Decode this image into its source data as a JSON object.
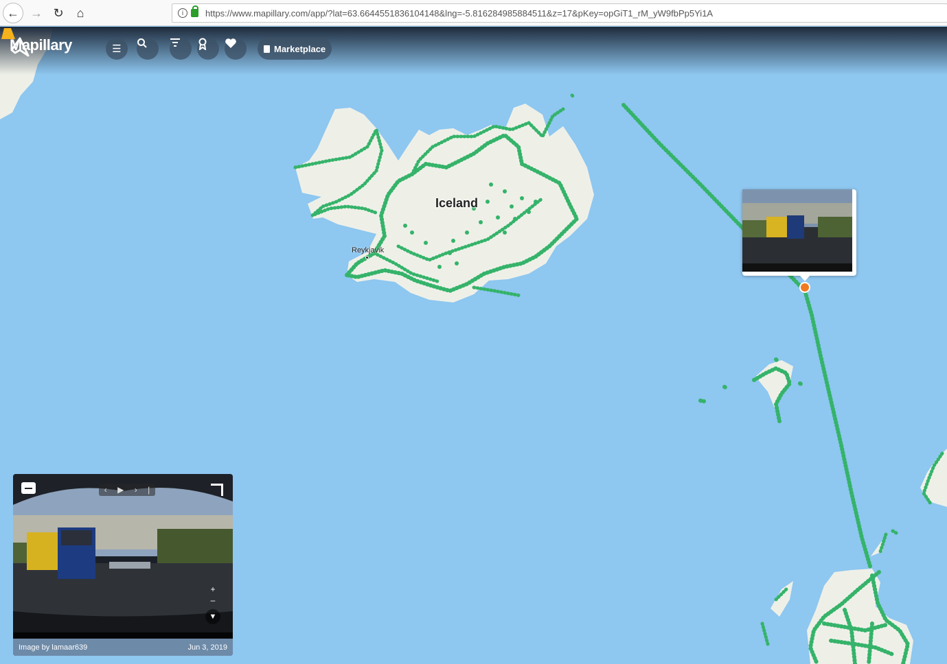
{
  "browser": {
    "url": "https://www.mapillary.com/app/?lat=63.6644551836104148&lng=-5.816284985884511&z=17&pKey=opGiT1_rM_yW9fbPp5Yi1A"
  },
  "app": {
    "brand": "Mapillary",
    "toolbar": {
      "marketplace_label": "Marketplace"
    }
  },
  "map": {
    "labels": {
      "country": "Iceland",
      "city": "Reykjavik"
    },
    "colors": {
      "sea": "#8ec7f0",
      "land": "#eef0e8",
      "coverage": "#35b36a",
      "marker": "#f07a20"
    }
  },
  "viewer": {
    "credit": "Image by lamaar639",
    "date": "Jun 3, 2019"
  }
}
